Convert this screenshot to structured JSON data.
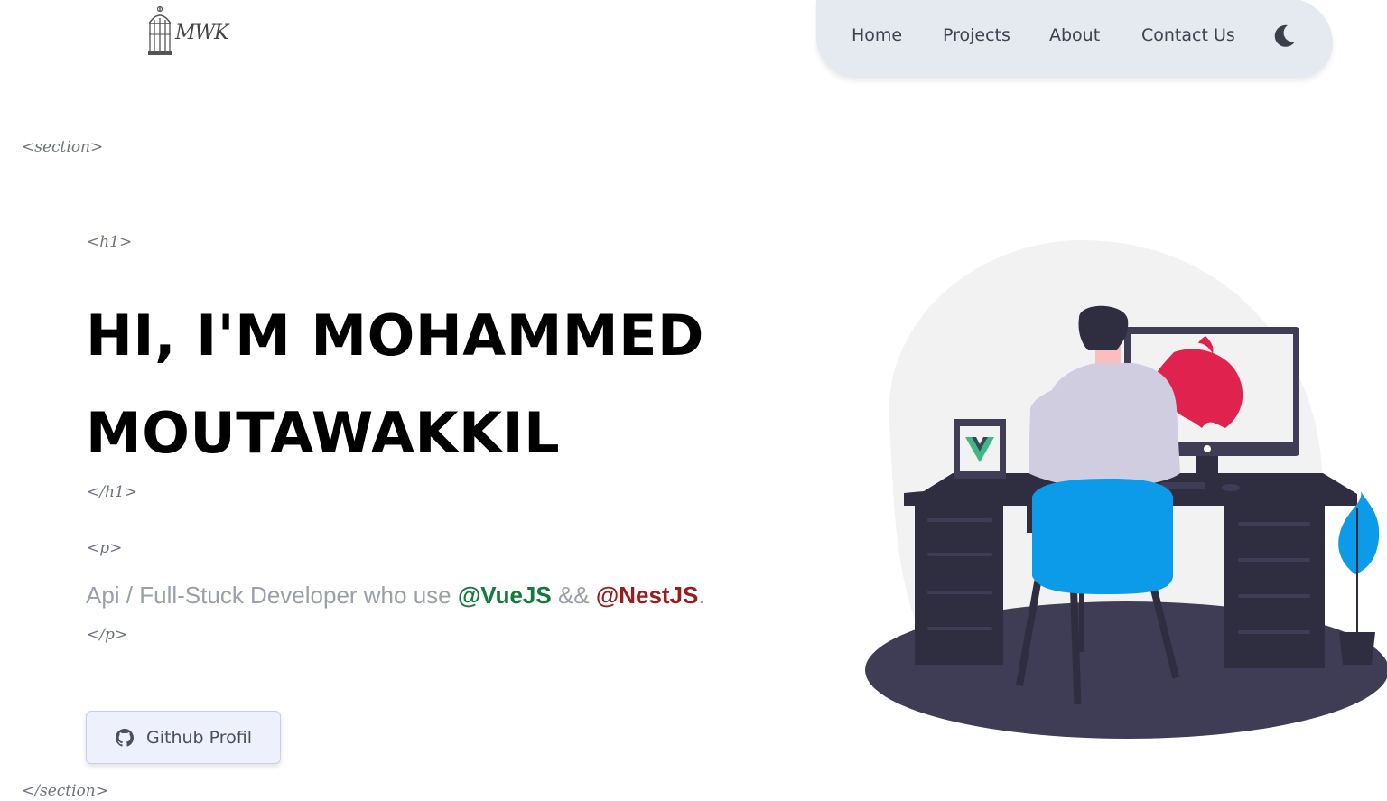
{
  "logo": {
    "text": "MWK",
    "icon": "birdcage-icon"
  },
  "nav": {
    "items": [
      {
        "label": "Home"
      },
      {
        "label": "Projects"
      },
      {
        "label": "About"
      },
      {
        "label": "Contact Us"
      }
    ],
    "theme_toggle_icon": "moon-icon"
  },
  "tags": {
    "section_open": "<section>",
    "h1_open": "<h1>",
    "h1_close": "</h1>",
    "p_open": "<p>",
    "p_close": "</p>",
    "section_close": "</section>"
  },
  "hero": {
    "title_line1": "HI, I'M MOHAMMED",
    "title_line2": "MOUTAWAKKIL",
    "subtitle_prefix": "Api / Full-Stuck Developer who use ",
    "subtitle_vue": "@VueJS",
    "subtitle_and": " && ",
    "subtitle_nest": "@NestJS",
    "subtitle_suffix": "."
  },
  "cta": {
    "label": "Github Profil",
    "icon": "github-icon"
  },
  "colors": {
    "nav_bg": "#e5e9f0",
    "vue_green": "#137a3c",
    "nest_red": "#9b1c1c",
    "chair_blue": "#0b9be8",
    "nest_logo": "#e0234e",
    "desk_dark": "#2f2e41"
  },
  "illustration": {
    "name": "developer-at-desk-illustration"
  }
}
